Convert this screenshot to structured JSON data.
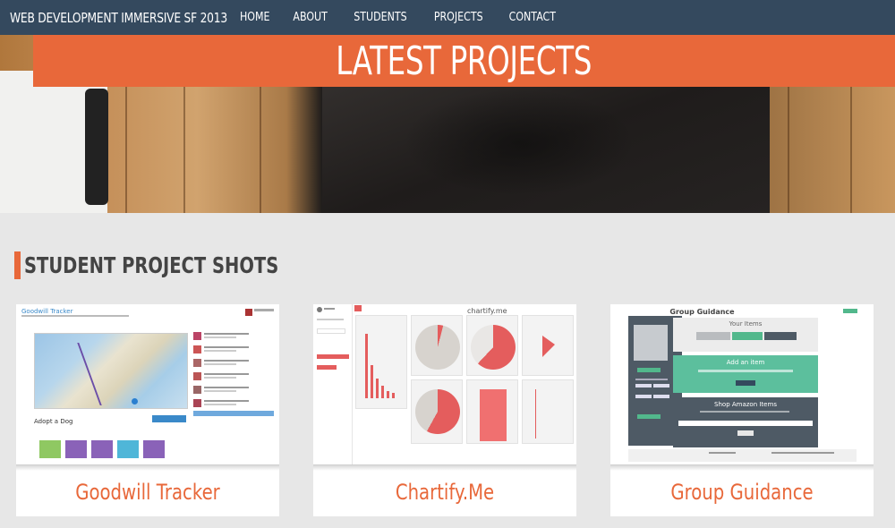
{
  "nav": {
    "brand": "WEB DEVELOPMENT IMMERSIVE SF 2013",
    "links": [
      "HOME",
      "ABOUT",
      "STUDENTS",
      "PROJECTS",
      "CONTACT"
    ]
  },
  "hero": {
    "title": "LATEST PROJECTS"
  },
  "section": {
    "title": "STUDENT PROJECT SHOTS"
  },
  "projects": [
    {
      "name": "Goodwill Tracker",
      "screenshot": {
        "header": "Goodwill Tracker",
        "item": "Adopt a Dog"
      }
    },
    {
      "name": "Chartify.Me",
      "screenshot": {
        "logo": "chartify.me"
      }
    },
    {
      "name": "Group Guidance",
      "screenshot": {
        "header": "Group Guidance",
        "box1": "Your Items",
        "box2": "Add an item",
        "box3": "Shop Amazon Items"
      }
    }
  ],
  "colors": {
    "nav": "#34495e",
    "accent": "#e8683a",
    "background": "#e7e7e7"
  }
}
